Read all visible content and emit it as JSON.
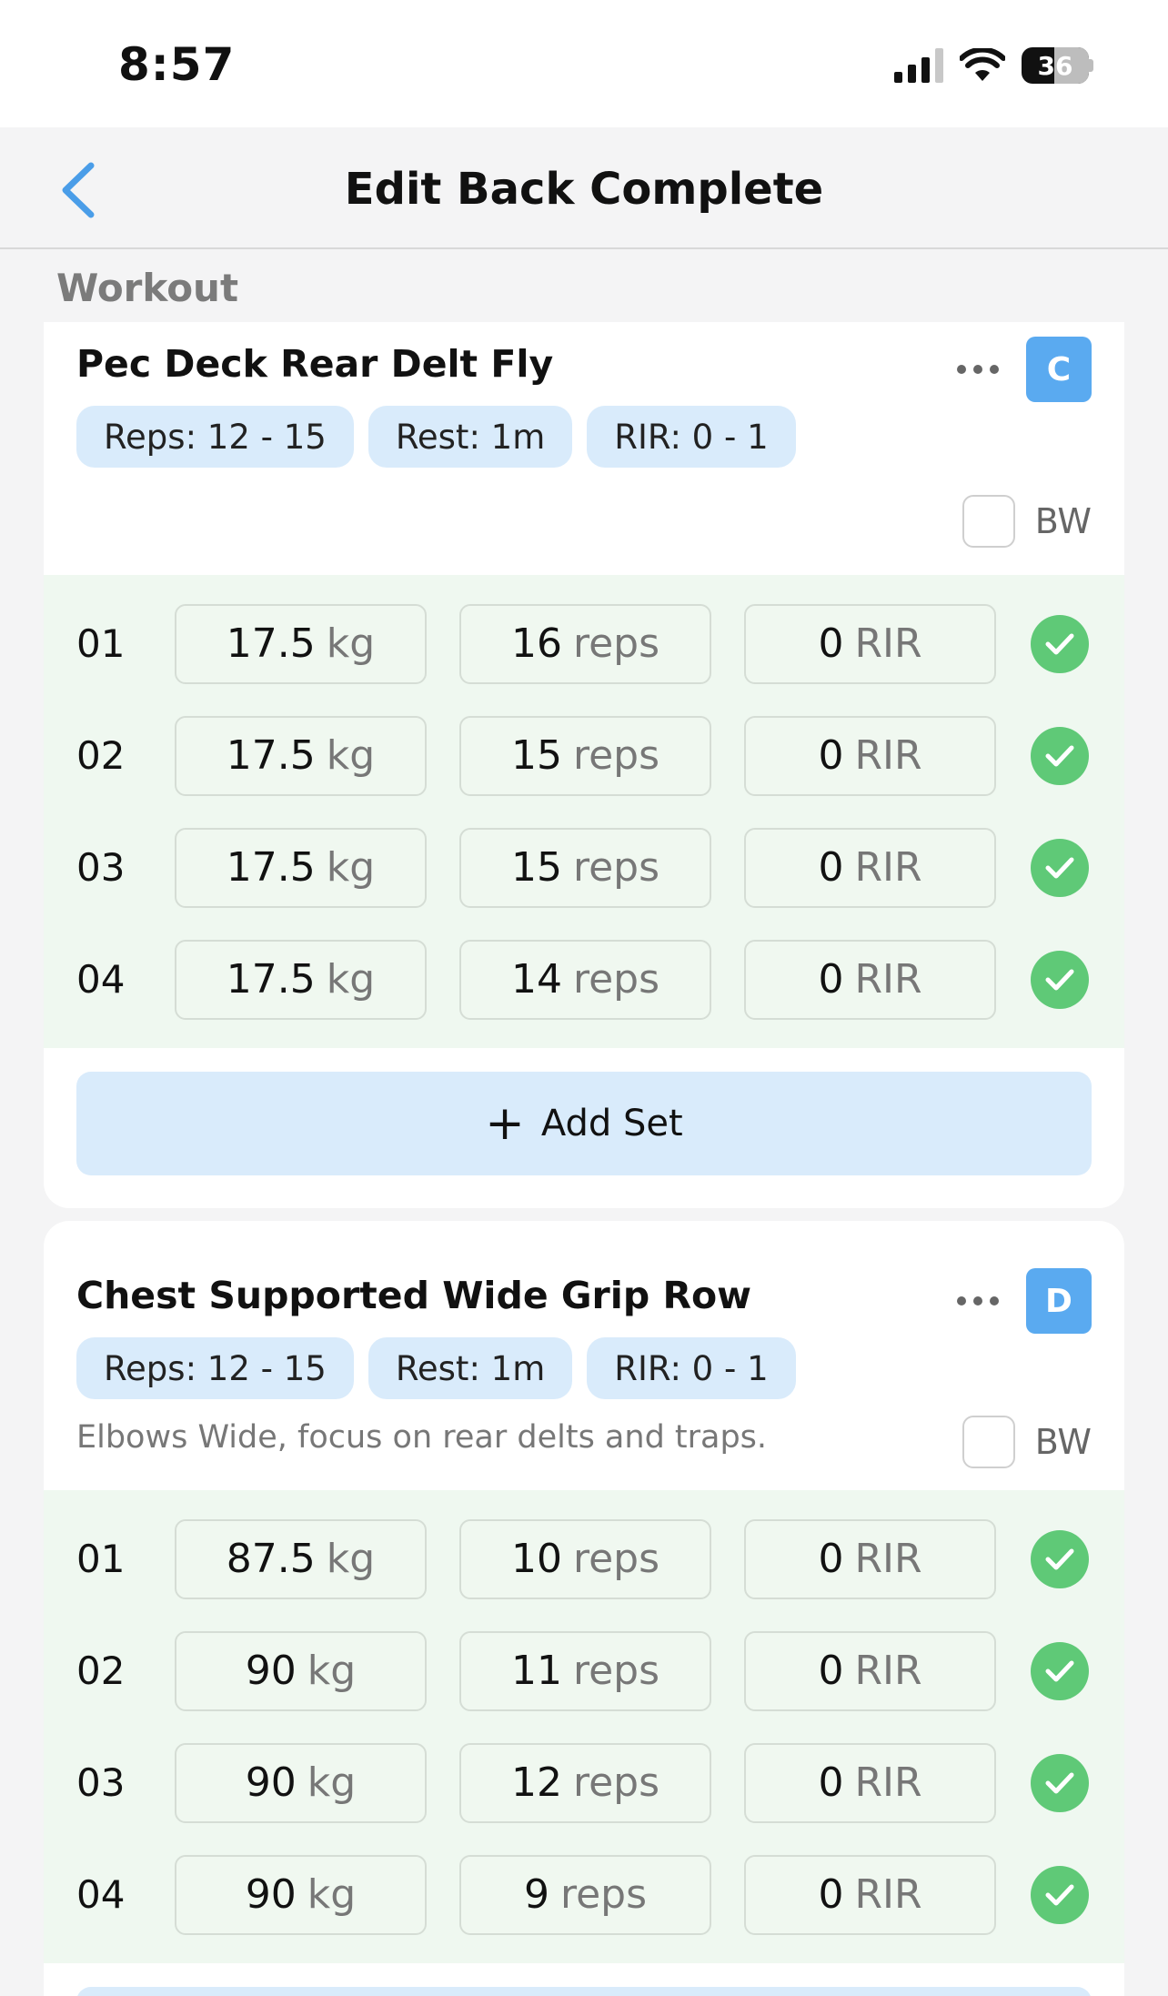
{
  "status_bar": {
    "time": "8:57",
    "battery": "36"
  },
  "nav": {
    "title": "Edit Back Complete"
  },
  "section_label": "Workout",
  "exercises": [
    {
      "name": "Pec Deck Rear Delt Fly",
      "badge": "C",
      "chips": [
        "Reps: 12 - 15",
        "Rest: 1m",
        "RIR: 0 - 1"
      ],
      "note": "",
      "bw_label": "BW",
      "sets": [
        {
          "num": "01",
          "weight": "17.5",
          "weight_unit": "kg",
          "reps": "16",
          "reps_unit": "reps",
          "rir": "0",
          "rir_unit": "RIR"
        },
        {
          "num": "02",
          "weight": "17.5",
          "weight_unit": "kg",
          "reps": "15",
          "reps_unit": "reps",
          "rir": "0",
          "rir_unit": "RIR"
        },
        {
          "num": "03",
          "weight": "17.5",
          "weight_unit": "kg",
          "reps": "15",
          "reps_unit": "reps",
          "rir": "0",
          "rir_unit": "RIR"
        },
        {
          "num": "04",
          "weight": "17.5",
          "weight_unit": "kg",
          "reps": "14",
          "reps_unit": "reps",
          "rir": "0",
          "rir_unit": "RIR"
        }
      ],
      "add_set_label": "Add Set"
    },
    {
      "name": "Chest Supported Wide Grip Row",
      "badge": "D",
      "chips": [
        "Reps: 12 - 15",
        "Rest: 1m",
        "RIR: 0 - 1"
      ],
      "note": "Elbows Wide, focus on rear delts and traps.",
      "bw_label": "BW",
      "sets": [
        {
          "num": "01",
          "weight": "87.5",
          "weight_unit": "kg",
          "reps": "10",
          "reps_unit": "reps",
          "rir": "0",
          "rir_unit": "RIR"
        },
        {
          "num": "02",
          "weight": "90",
          "weight_unit": "kg",
          "reps": "11",
          "reps_unit": "reps",
          "rir": "0",
          "rir_unit": "RIR"
        },
        {
          "num": "03",
          "weight": "90",
          "weight_unit": "kg",
          "reps": "12",
          "reps_unit": "reps",
          "rir": "0",
          "rir_unit": "RIR"
        },
        {
          "num": "04",
          "weight": "90",
          "weight_unit": "kg",
          "reps": "9",
          "reps_unit": "reps",
          "rir": "0",
          "rir_unit": "RIR"
        }
      ]
    }
  ],
  "colors": {
    "accent": "#5aaaf0",
    "chip_bg": "#d9ebfb",
    "set_row_bg": "#eff8f0",
    "check_green": "#5fc977"
  }
}
